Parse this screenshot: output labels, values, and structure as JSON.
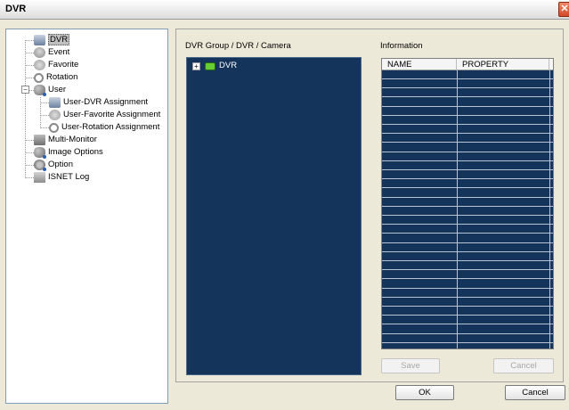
{
  "window": {
    "title": "DVR",
    "close_glyph": "✕"
  },
  "tree": {
    "items": [
      {
        "label": "DVR",
        "icon": "dvr-icon",
        "selected": true
      },
      {
        "label": "Event",
        "icon": "event-icon"
      },
      {
        "label": "Favorite",
        "icon": "favorite-icon"
      },
      {
        "label": "Rotation",
        "icon": "rotation-icon"
      },
      {
        "label": "User",
        "icon": "user-icon",
        "expanded": true,
        "expander": "−"
      },
      {
        "label": "User-DVR Assignment",
        "icon": "user-dvr-icon"
      },
      {
        "label": "User-Favorite Assignment",
        "icon": "user-favorite-icon"
      },
      {
        "label": "User-Rotation Assignment",
        "icon": "user-rotation-icon"
      },
      {
        "label": "Multi-Monitor",
        "icon": "multi-monitor-icon"
      },
      {
        "label": "Image Options",
        "icon": "image-options-icon"
      },
      {
        "label": "Option",
        "icon": "option-icon"
      },
      {
        "label": "ISNET Log",
        "icon": "isnet-log-icon"
      }
    ]
  },
  "camera_section": {
    "label": "DVR Group / DVR / Camera",
    "root": {
      "label": "DVR",
      "expander": "+",
      "icon": "dvr-green-icon"
    }
  },
  "info_section": {
    "label": "Information",
    "columns": [
      "NAME",
      "PROPERTY"
    ],
    "row_count": 31
  },
  "buttons": {
    "save": "Save",
    "cancel_inner": "Cancel",
    "ok": "OK",
    "cancel": "Cancel"
  },
  "colors": {
    "panel_bg": "#14345c",
    "window_bg": "#ece9d8",
    "selection": "#c0c0c0"
  }
}
